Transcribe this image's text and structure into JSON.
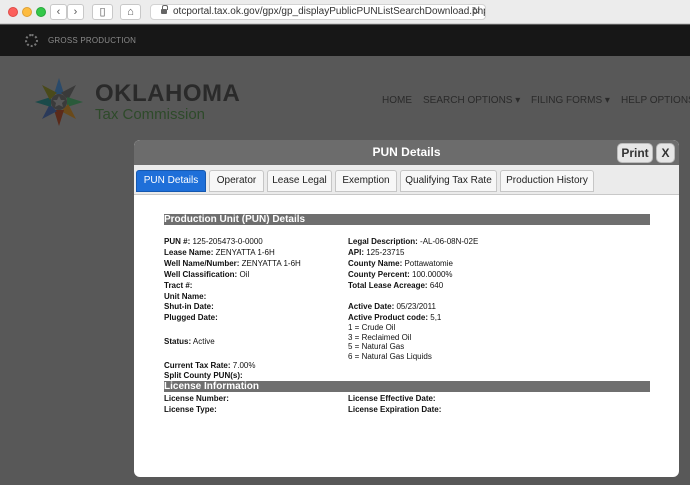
{
  "browser": {
    "url": "otcportal.tax.ok.gov/gpx/gp_displayPublicPUNListSearchDownload.php"
  },
  "site": {
    "topbar_title": "GROSS PRODUCTION",
    "logo_title": "OKLAHOMA",
    "logo_subtitle": "Tax Commission",
    "menu": [
      "HOME",
      "SEARCH OPTIONS ▾",
      "FILING FORMS ▾",
      "HELP OPTIONS"
    ]
  },
  "modal": {
    "title": "PUN Details",
    "print_label": "Print",
    "close_label": "X",
    "tabs": [
      "PUN Details",
      "Operator",
      "Lease Legal",
      "Exemption",
      "Qualifying Tax Rate",
      "Production History"
    ],
    "active_tab": "PUN Details",
    "section1_title": "Production Unit (PUN) Details",
    "left": [
      {
        "label": "PUN #:",
        "value": "125-205473-0-0000"
      },
      {
        "label": "Lease Name:",
        "value": "ZENYATTA 1-6H"
      },
      {
        "label": "Well Name/Number:",
        "value": "ZENYATTA 1-6H"
      },
      {
        "label": "Well Classification:",
        "value": "Oil"
      },
      {
        "label": "Tract #:",
        "value": ""
      },
      {
        "label": "Unit Name:",
        "value": ""
      },
      {
        "label": "Shut-in Date:",
        "value": ""
      },
      {
        "label": "Plugged Date:",
        "value": ""
      },
      {
        "label": "Status:",
        "value": "Active"
      },
      {
        "label": "Current Tax Rate:",
        "value": "7.00%"
      },
      {
        "label": "Split County PUN(s):",
        "value": ""
      }
    ],
    "right": [
      {
        "label": "Legal Description:",
        "value": "-AL-06-08N-02E"
      },
      {
        "label": "API:",
        "value": "125-23715"
      },
      {
        "label": "County Name:",
        "value": "Pottawatomie"
      },
      {
        "label": "County Percent:",
        "value": "100.0000%"
      },
      {
        "label": "Total Lease Acreage:",
        "value": "640"
      },
      {
        "label": "Active Date:",
        "value": "05/23/2011"
      },
      {
        "label": "Active Product code:",
        "value": "5,1"
      }
    ],
    "product_codes": [
      "1 = Crude Oil",
      "3 = Reclaimed Oil",
      "5 = Natural Gas",
      "6 = Natural Gas Liquids"
    ],
    "section2_title": "License Information",
    "license_left": [
      {
        "label": "License Number:",
        "value": ""
      },
      {
        "label": "License Type:",
        "value": ""
      }
    ],
    "license_right": [
      {
        "label": "License Effective Date:",
        "value": ""
      },
      {
        "label": "License Expiration Date:",
        "value": ""
      }
    ]
  }
}
